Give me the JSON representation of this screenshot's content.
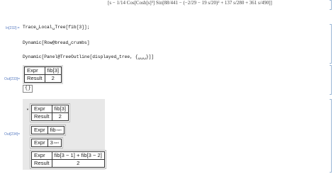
{
  "header": {
    "formula_fragment": "[s − 1/14 Cos[Cosh[s]³] Sin[88/441 − (−2/29 − 19 s/20)² + 137 s/280 + 361 s/490]]",
    "inert_tag": "inert"
  },
  "cells": {
    "in_label": "In[232]:=",
    "line1": "Trace␣Local␣Tree[fib[3]];",
    "line2": "Dynamic[Row@bread␣crumbs]",
    "line3": "Dynamic[Panel@TreeOutline[displayed␣tree, {␣␣␣}]]",
    "out233_label": "Out[233]=",
    "out234_label": "Out[234]="
  },
  "crumbs_grid": {
    "row1": {
      "key": "Expr",
      "value": "fib[3]"
    },
    "row2": {
      "key": "Result",
      "value": "2"
    }
  },
  "empty_list": "{}",
  "tree_panel": {
    "node1": {
      "key": "Expr",
      "value": "fib[3]",
      "result_key": "Result",
      "result_value": "2"
    },
    "node2": {
      "key": "Expr",
      "value": "fib",
      "tag": "inert"
    },
    "node3": {
      "key": "Expr",
      "value": "3",
      "tag": "inert"
    },
    "node4": {
      "key": "Expr",
      "value": "fib[3 − 1] + fib[3 − 2]",
      "result_key": "Result",
      "result_value": "2"
    }
  }
}
